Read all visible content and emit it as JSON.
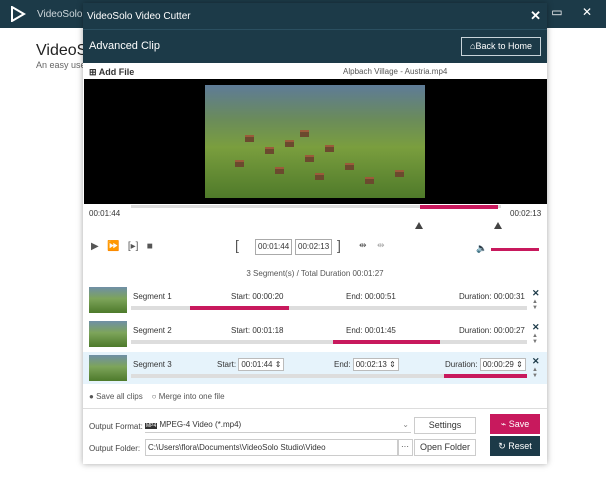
{
  "background_app": {
    "title": "VideoSolo V",
    "heading": "VideoSol",
    "subtext": "An easy use",
    "window_controls": "— ▭ ✕"
  },
  "dialog": {
    "title": "VideoSolo Video Cutter",
    "close_glyph": "✕",
    "header_title": "Advanced Clip",
    "back_button": "Back to Home",
    "add_file": "Add File",
    "file_name": "Alpbach Village - Austria.mp4",
    "time_start": "00:01:44",
    "time_end": "00:02:13",
    "clip_start_input": "00:01:44",
    "clip_end_input": "00:02:13",
    "segment_summary": "3 Segment(s) / Total Duration 00:01:27",
    "segments": [
      {
        "label": "Segment 1",
        "start_label": "Start:",
        "start": "00:00:20",
        "end_label": "End:",
        "end": "00:00:51",
        "duration_label": "Duration:",
        "duration": "00:00:31",
        "fill_start": 0.15,
        "fill_end": 0.4
      },
      {
        "label": "Segment 2",
        "start_label": "Start:",
        "start": "00:01:18",
        "end_label": "End:",
        "end": "00:01:45",
        "duration_label": "Duration:",
        "duration": "00:00:27",
        "fill_start": 0.51,
        "fill_end": 0.78
      },
      {
        "label": "Segment 3",
        "start_label": "Start:",
        "start": "00:01:44",
        "end_label": "End:",
        "end": "00:02:13",
        "duration_label": "Duration:",
        "duration": "00:00:29",
        "fill_start": 0.79,
        "fill_end": 1.0
      }
    ],
    "options": {
      "save_all": "Save all clips",
      "merge": "Merge into one file"
    },
    "output_format_label": "Output Format:",
    "output_format_value": "MPEG-4 Video (*.mp4)",
    "settings_button": "Settings",
    "save_button": "Save",
    "output_folder_label": "Output Folder:",
    "output_folder_value": "C:\\Users\\flora\\Documents\\VideoSolo Studio\\Video",
    "browse_button": "···",
    "open_folder_button": "Open Folder",
    "reset_button": "Reset"
  },
  "colors": {
    "titlebar": "#1c3a48",
    "accent": "#c8195d"
  },
  "icons": [
    "play-icon",
    "fast-forward-icon",
    "frame-step-icon",
    "stop-icon",
    "bracket-left-icon",
    "bracket-right-icon",
    "split-icon",
    "merge-icon",
    "volume-icon",
    "close-icon",
    "arrow-up-icon",
    "arrow-down-icon",
    "folder-dots-icon"
  ]
}
